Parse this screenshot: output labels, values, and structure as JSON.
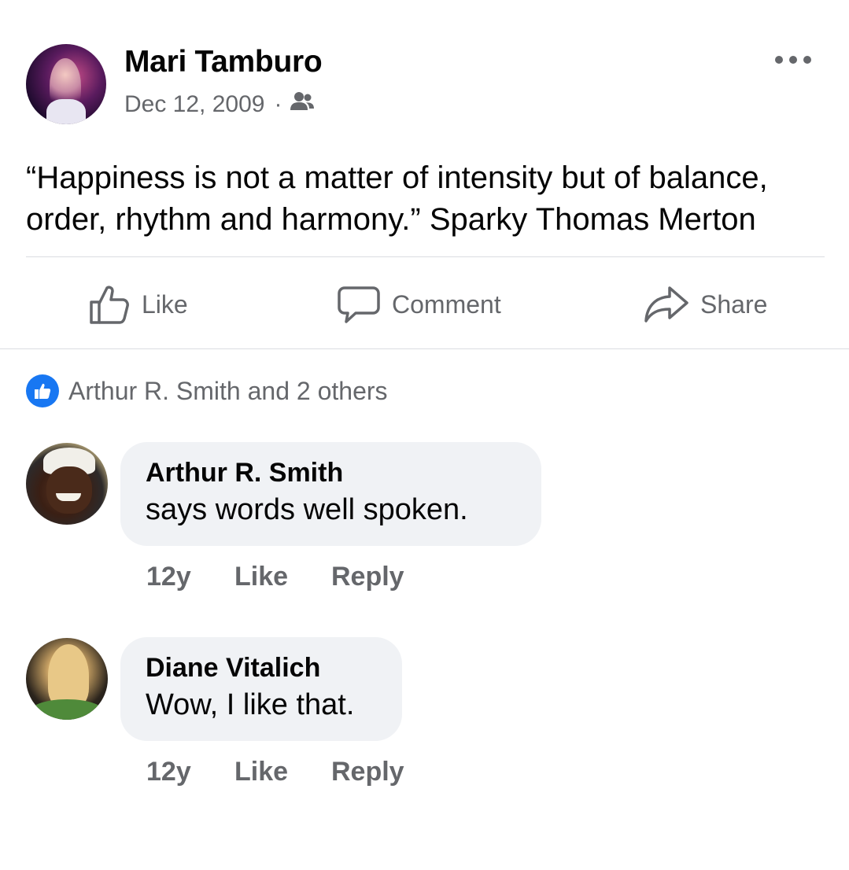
{
  "post": {
    "author": "Mari Tamburo",
    "date": "Dec 12, 2009",
    "separator": "·",
    "audience_icon": "friends-icon",
    "more_icon": "more-options-icon",
    "text": "“Happiness is not a matter of intensity but of balance, order, rhythm and harmony.” Sparky Thomas Merton"
  },
  "actions": {
    "like": "Like",
    "comment": "Comment",
    "share": "Share"
  },
  "reactions": {
    "icon": "like-reaction-icon",
    "summary": "Arthur R. Smith and 2 others"
  },
  "comments": [
    {
      "author": "Arthur R. Smith",
      "text": "says words well spoken.",
      "age": "12y",
      "like": "Like",
      "reply": "Reply"
    },
    {
      "author": "Diane Vitalich",
      "text": "Wow, I like that.",
      "age": "12y",
      "like": "Like",
      "reply": "Reply"
    }
  ],
  "colors": {
    "accent": "#1877f2",
    "secondary_text": "#65676b",
    "bubble": "#f0f2f5",
    "divider": "#dadde1"
  }
}
